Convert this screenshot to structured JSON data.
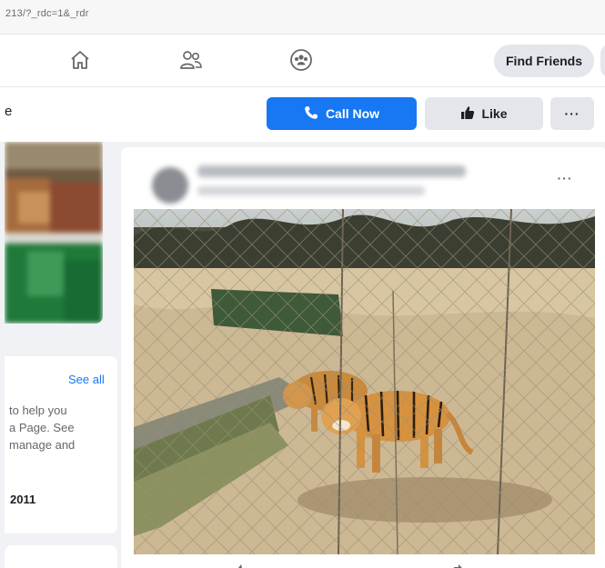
{
  "browser": {
    "url_fragment": "213/?_rdc=1&_rdr"
  },
  "topnav": {
    "icons": [
      "home-icon",
      "friends-icon",
      "groups-icon"
    ],
    "find_friends_label": "Find Friends"
  },
  "page_header": {
    "name_fragment": "e",
    "call_now_label": "Call Now",
    "like_label": "Like",
    "more_label": "···"
  },
  "about": {
    "see_all_label": "See all",
    "intro_lines": [
      "to help you",
      "a Page. See",
      "manage and"
    ],
    "year": "2011"
  },
  "post": {
    "more_label": "···"
  },
  "colors": {
    "brand_blue": "#1877f2",
    "button_grey": "#e4e6eb",
    "page_bg": "#f0f2f5"
  }
}
